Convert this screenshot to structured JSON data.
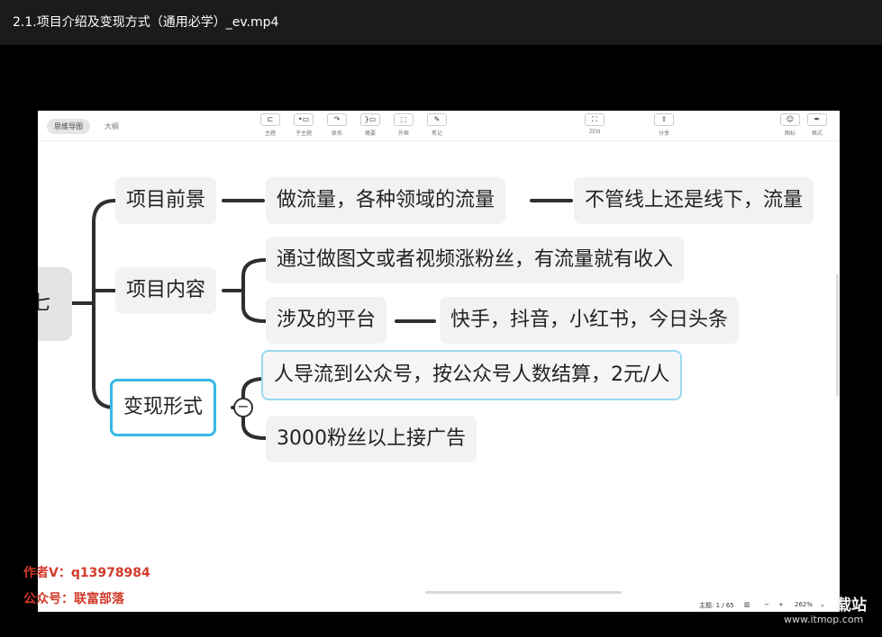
{
  "window": {
    "title": "2.1.项目介绍及变现方式（通用必学）_ev.mp4"
  },
  "toolbar": {
    "mode_tabs": [
      "思维导图",
      "大纲"
    ],
    "tools": [
      {
        "icon": "topic-icon",
        "label": "主题"
      },
      {
        "icon": "subtopic-icon",
        "label": "子主题"
      },
      {
        "icon": "link-icon",
        "label": "联系"
      },
      {
        "icon": "summary-icon",
        "label": "概要"
      },
      {
        "icon": "boundary-icon",
        "label": "外框"
      },
      {
        "icon": "note-icon",
        "label": "笔记"
      },
      {
        "icon": "zen-icon",
        "label": "ZEN"
      },
      {
        "icon": "share-icon",
        "label": "分享"
      },
      {
        "icon": "icon-icon",
        "label": "图标"
      },
      {
        "icon": "format-icon",
        "label": "格式"
      }
    ]
  },
  "mindmap": {
    "root": "七",
    "branches": [
      {
        "label": "项目前景",
        "children": [
          {
            "label": "做流量，各种领域的流量",
            "children": [
              {
                "label": "不管线上还是线下，流量"
              }
            ]
          }
        ]
      },
      {
        "label": "项目内容",
        "children": [
          {
            "label": "通过做图文或者视频涨粉丝，有流量就有收入"
          },
          {
            "label": "涉及的平台",
            "children": [
              {
                "label": "快手，抖音，小红书，今日头条"
              }
            ]
          }
        ]
      },
      {
        "label": "变现形式",
        "children": [
          {
            "label": "人导流到公众号，按公众号人数结算，2元/人"
          },
          {
            "label": "3000粉丝以上接广告"
          }
        ]
      }
    ],
    "collapse_symbol": "−"
  },
  "statusbar": {
    "topic_count": "主题: 1 / 65",
    "zoom": "262%"
  },
  "watermarks": {
    "left_line1": "作者V：q13978984",
    "left_line2": "公众号：联富部落",
    "right_line1": "载站",
    "right_line2": "www.itmop.com"
  }
}
